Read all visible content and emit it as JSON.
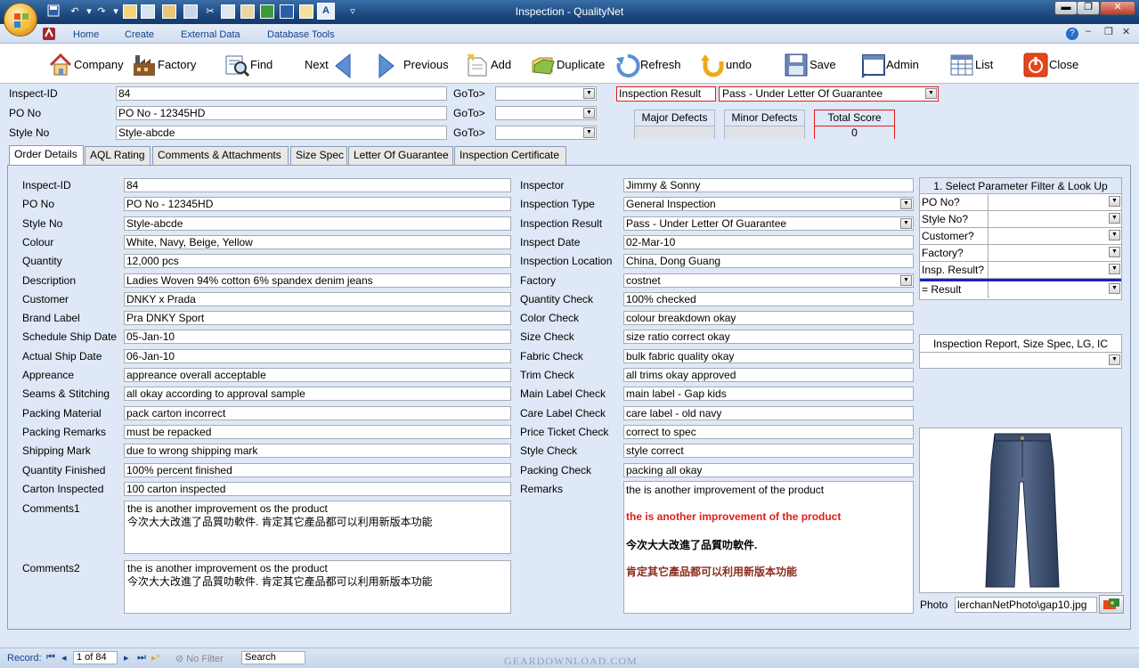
{
  "window": {
    "title": "Inspection - QualityNet"
  },
  "ribbon": {
    "tabs": [
      "Home",
      "Create",
      "External Data",
      "Database Tools"
    ]
  },
  "toolbar": {
    "company": "Company",
    "factory": "Factory",
    "find": "Find",
    "next": "Next",
    "previous": "Previous",
    "add": "Add",
    "duplicate": "Duplicate",
    "refresh": "Refresh",
    "undo": "undo",
    "save": "Save",
    "admin": "Admin",
    "list": "List",
    "close": "Close"
  },
  "header": {
    "inspect_id_label": "Inspect-ID",
    "inspect_id": "84",
    "po_label": "PO No",
    "po": "PO No - 12345HD",
    "style_label": "Style No",
    "style": "Style-abcde",
    "goto": "GoTo>",
    "result_label": "Inspection Result",
    "result": "Pass - Under Letter Of Guarantee",
    "major_label": "Major Defects",
    "minor_label": "Minor Defects",
    "total_label": "Total Score",
    "total": "0"
  },
  "tabs": [
    "Order Details",
    "AQL Rating",
    "Comments & Attachments",
    "Size Spec",
    "Letter Of Guarantee",
    "Inspection Certificate"
  ],
  "left_fields": [
    {
      "label": "Inspect-ID",
      "value": "84"
    },
    {
      "label": "PO No",
      "value": "PO No - 12345HD"
    },
    {
      "label": "Style No",
      "value": "Style-abcde"
    },
    {
      "label": "Colour",
      "value": "White, Navy, Beige, Yellow"
    },
    {
      "label": "Quantity",
      "value": "12,000 pcs"
    },
    {
      "label": "Description",
      "value": "Ladies Woven 94% cotton 6% spandex denim jeans"
    },
    {
      "label": "Customer",
      "value": "DNKY x Prada"
    },
    {
      "label": "Brand Label",
      "value": "Pra DNKY Sport"
    },
    {
      "label": "Schedule Ship Date",
      "value": "05-Jan-10"
    },
    {
      "label": "Actual Ship Date",
      "value": "06-Jan-10"
    },
    {
      "label": "Appreance",
      "value": "appreance overall acceptable"
    },
    {
      "label": "Seams & Stitching",
      "value": "all okay according to approval sample"
    },
    {
      "label": "Packing Material",
      "value": "pack carton incorrect"
    },
    {
      "label": "Packing Remarks",
      "value": "must be repacked"
    },
    {
      "label": "Shipping Mark",
      "value": "due to wrong shipping mark"
    },
    {
      "label": "Quantity Finished",
      "value": "100% percent finished"
    },
    {
      "label": "Carton Inspected",
      "value": "100 carton inspected"
    }
  ],
  "comments1": {
    "label": "Comments1",
    "line1": "the is another improvement os the product",
    "line2": "今次大大改進了品質叻軟件. 肯定其它產品都可以利用新版本功能"
  },
  "comments2": {
    "label": "Comments2",
    "line1": "the is another improvement os the product",
    "line2": "今次大大改進了品質叻軟件. 肯定其它產品都可以利用新版本功能"
  },
  "right_fields": [
    {
      "label": "Inspector",
      "value": "Jimmy & Sonny",
      "dropdown": false
    },
    {
      "label": "Inspection Type",
      "value": "General Inspection",
      "dropdown": true
    },
    {
      "label": "Inspection Result",
      "value": "Pass - Under Letter Of Guarantee",
      "dropdown": true
    },
    {
      "label": "Inspect Date",
      "value": "02-Mar-10",
      "dropdown": false
    },
    {
      "label": "Inspection Location",
      "value": "China, Dong Guang",
      "dropdown": false
    },
    {
      "label": "Factory",
      "value": "costnet",
      "dropdown": true
    },
    {
      "label": "Quantity Check",
      "value": "100% checked",
      "dropdown": false
    },
    {
      "label": "Color Check",
      "value": "colour breakdown okay",
      "dropdown": false
    },
    {
      "label": "Size Check",
      "value": "size ratio correct okay",
      "dropdown": false
    },
    {
      "label": "Fabric Check",
      "value": "bulk fabric quality okay",
      "dropdown": false
    },
    {
      "label": "Trim Check",
      "value": "all trims okay approved",
      "dropdown": false
    },
    {
      "label": "Main Label Check",
      "value": "main label - Gap kids",
      "dropdown": false
    },
    {
      "label": "Care Label Check",
      "value": "care label - old navy",
      "dropdown": false
    },
    {
      "label": "Price Ticket Check",
      "value": "correct to spec",
      "dropdown": false
    },
    {
      "label": "Style Check",
      "value": "style correct",
      "dropdown": false
    },
    {
      "label": "Packing Check",
      "value": "packing all okay",
      "dropdown": false
    }
  ],
  "remarks": {
    "label": "Remarks",
    "line1": "the is another improvement of the product",
    "line2": "the is another improvement of the product",
    "line3": "今次大大改進了品質叻軟件.",
    "line4": "肯定其它產品都可以利用新版本功能",
    "color2": "#e31b1b",
    "color4": "#8b2b1b"
  },
  "filter": {
    "title": "1. Select Parameter Filter & Look Up",
    "rows": [
      "PO No?",
      "Style No?",
      "Customer?",
      "Factory?",
      "Insp. Result?"
    ],
    "result": "= Result"
  },
  "report": {
    "title": "Inspection Report, Size Spec, LG, IC"
  },
  "photo": {
    "label": "Photo",
    "path": "lerchanNetPhoto\\gap10.jpg"
  },
  "status": {
    "record_label": "Record:",
    "record": "1 of 84",
    "filter": "No Filter",
    "search": "Search"
  },
  "watermark": "GEARDOWNLOAD.COM"
}
